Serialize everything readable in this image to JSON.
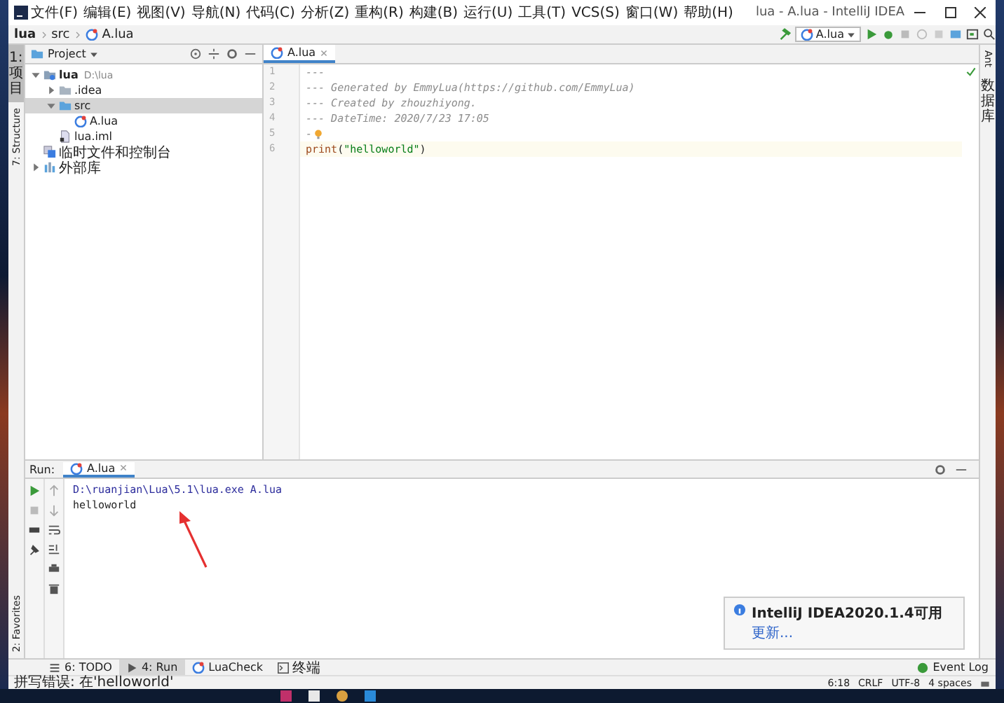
{
  "window": {
    "title": "lua - A.lua - IntelliJ IDEA"
  },
  "menu": [
    "文件(F)",
    "编辑(E)",
    "视图(V)",
    "导航(N)",
    "代码(C)",
    "分析(Z)",
    "重构(R)",
    "构建(B)",
    "运行(U)",
    "工具(T)",
    "VCS(S)",
    "窗口(W)",
    "帮助(H)"
  ],
  "breadcrumbs": [
    "lua",
    "src",
    "A.lua"
  ],
  "run_config": "A.lua",
  "left_tool_tabs": [
    {
      "label": "1: 项目",
      "selected": true,
      "kind": "cjk"
    },
    {
      "label": "7: Structure",
      "selected": false,
      "kind": "latin"
    }
  ],
  "left_bottom_tabs": [
    {
      "label": "2: Favorites",
      "selected": false
    }
  ],
  "right_tool_tabs": [
    {
      "label": "Ant",
      "selected": false,
      "kind": "latin"
    },
    {
      "label": "数据库",
      "selected": false,
      "kind": "cjk"
    }
  ],
  "project": {
    "title": "Project",
    "tree": [
      {
        "name": "lua",
        "note": "D:\\lua",
        "kind": "module",
        "expanded": true,
        "selected": false,
        "children": [
          {
            "name": ".idea",
            "kind": "folder",
            "expanded": false,
            "selected": false
          },
          {
            "name": "src",
            "kind": "source",
            "expanded": true,
            "selected": true,
            "children": [
              {
                "name": "A.lua",
                "kind": "lua",
                "selected": false
              }
            ]
          },
          {
            "name": "lua.iml",
            "kind": "iml",
            "selected": false
          }
        ]
      },
      {
        "name": "临时文件和控制台",
        "kind": "scratch",
        "selected": false
      },
      {
        "name": "外部库",
        "kind": "library",
        "expanded": false,
        "selected": false
      }
    ]
  },
  "editor": {
    "tabs": [
      {
        "label": "A.lua",
        "selected": true
      }
    ],
    "lines": [
      {
        "number": "1",
        "current": false,
        "tokens": [
          {
            "kind": "comment",
            "text": "---"
          }
        ]
      },
      {
        "number": "2",
        "current": false,
        "tokens": [
          {
            "kind": "comment",
            "text": "--- Generated by EmmyLua(https://github.com/EmmyLua)"
          }
        ]
      },
      {
        "number": "3",
        "current": false,
        "tokens": [
          {
            "kind": "comment",
            "text": "--- Created by zhouzhiyong."
          }
        ]
      },
      {
        "number": "4",
        "current": false,
        "tokens": [
          {
            "kind": "comment",
            "text": "--- DateTime: 2020/7/23 17:05"
          }
        ]
      },
      {
        "number": "5",
        "current": false,
        "bulb": true,
        "tokens": [
          {
            "kind": "comment",
            "text": "-"
          }
        ]
      },
      {
        "number": "6",
        "current": true,
        "tokens": [
          {
            "kind": "function",
            "text": "print"
          },
          {
            "kind": "punct",
            "text": "("
          },
          {
            "kind": "string",
            "text": "\"helloworld\""
          },
          {
            "kind": "punct",
            "text": ")"
          }
        ]
      }
    ]
  },
  "run": {
    "label": "Run:",
    "tabs": [
      {
        "label": "A.lua",
        "selected": true
      }
    ],
    "output": [
      {
        "kind": "command",
        "text": "D:\\ruanjian\\Lua\\5.1\\lua.exe A.lua"
      },
      {
        "kind": "output",
        "text": "helloworld"
      }
    ]
  },
  "bottom_tool_tabs": [
    {
      "label": "6: TODO",
      "selected": false,
      "kind": "list"
    },
    {
      "label": "4: Run",
      "selected": true,
      "kind": "play"
    },
    {
      "label": "LuaCheck",
      "selected": false,
      "kind": "lua"
    },
    {
      "label": "终端",
      "selected": false,
      "kind": "terminal"
    }
  ],
  "event_log": "Event Log",
  "notification": {
    "title": "IntelliJ IDEA2020.1.4可用",
    "link": "更新..."
  },
  "status_bar": {
    "message": "拼写错误: 在'helloworld'",
    "items": [
      "6:18",
      "CRLF",
      "UTF-8",
      "4 spaces"
    ]
  }
}
